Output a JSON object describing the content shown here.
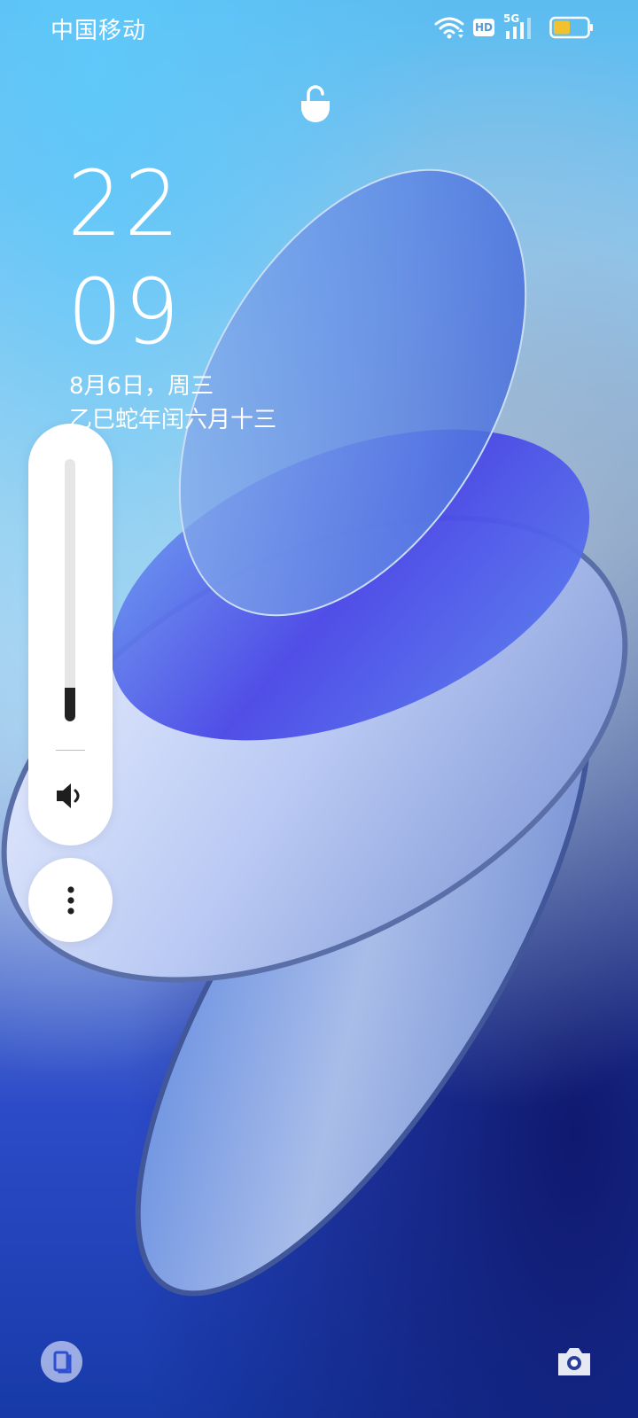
{
  "status_bar": {
    "carrier": "中国移动",
    "hd_badge": "HD",
    "network_type": "5G",
    "battery_level": 0.5,
    "battery_color": "#f2c12e",
    "wifi_icon": "wifi-icon",
    "signal_icon": "signal-bars-icon"
  },
  "lock_screen": {
    "lock_icon": "lock-icon",
    "clock": {
      "hour": "22",
      "minute": "09"
    },
    "date": "8月6日，周三",
    "lunar_date": "乙巳蛇年闰六月十三"
  },
  "volume_panel": {
    "level": 0.13,
    "icon": "speaker-icon",
    "more_icon": "more-vertical-icon"
  },
  "shortcuts": {
    "left_icon": "app-shortcut-icon",
    "right_icon": "camera-icon"
  },
  "colors": {
    "accent_blue": "#2c4bc8",
    "panel_background": "#ffffff",
    "volume_fill": "#222222"
  }
}
